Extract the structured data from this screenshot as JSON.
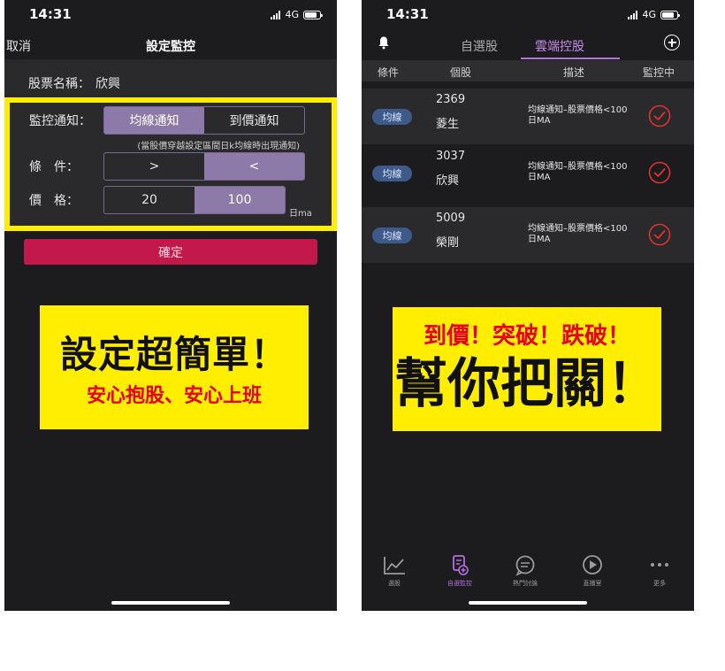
{
  "left": {
    "status": {
      "time": "14:31",
      "network": "4G"
    },
    "nav": {
      "cancel": "取消",
      "title": "設定監控"
    },
    "stock_name_label": "股票名稱：",
    "stock_name_value": "欣興",
    "monitor": {
      "label": "監控通知：",
      "options": [
        "均線通知",
        "到價通知"
      ],
      "selected": "均線通知",
      "hint": "(當股價穿越設定區間日k均線時出現通知)"
    },
    "condition": {
      "label": "條　件：",
      "options": [
        ">",
        "<"
      ],
      "selected": "<"
    },
    "price": {
      "label": "價　格：",
      "values": [
        "20",
        "100"
      ],
      "selected": "100",
      "unit": "日ma"
    },
    "confirm_label": "確定",
    "promo": {
      "line1": "設定超簡單！",
      "line2": "安心抱股、安心上班"
    }
  },
  "right": {
    "status": {
      "time": "14:31",
      "network": "4G"
    },
    "tabs": [
      "自選股",
      "雲端控股"
    ],
    "active_tab": "雲端控股",
    "columns": [
      "條件",
      "個股",
      "描述",
      "監控中"
    ],
    "rows": [
      {
        "tag": "均線",
        "code": "2369",
        "name": "菱生",
        "desc": "均線通知–股票價格<100日MA"
      },
      {
        "tag": "均線",
        "code": "3037",
        "name": "欣興",
        "desc": "均線通知–股票價格<100日MA"
      },
      {
        "tag": "均線",
        "code": "5009",
        "name": "榮剛",
        "desc": "均線通知–股票價格<100日MA"
      }
    ],
    "promo": {
      "line1": "到價！突破！跌破！",
      "line2": "幫你把關！"
    },
    "tabbar": [
      {
        "label": "選股",
        "icon": "chart-line-icon"
      },
      {
        "label": "自選監控",
        "icon": "watchlist-monitor-icon"
      },
      {
        "label": "熱門討論",
        "icon": "chat-bubble-icon"
      },
      {
        "label": "直播室",
        "icon": "play-circle-icon"
      },
      {
        "label": "更多",
        "icon": "more-dots-icon"
      }
    ],
    "active_tabbar": "自選監控",
    "colors": {
      "accent": "#b46fe0",
      "tag": "#3d5a8a",
      "check": "#e0322e",
      "highlight": "#ffee00"
    }
  }
}
